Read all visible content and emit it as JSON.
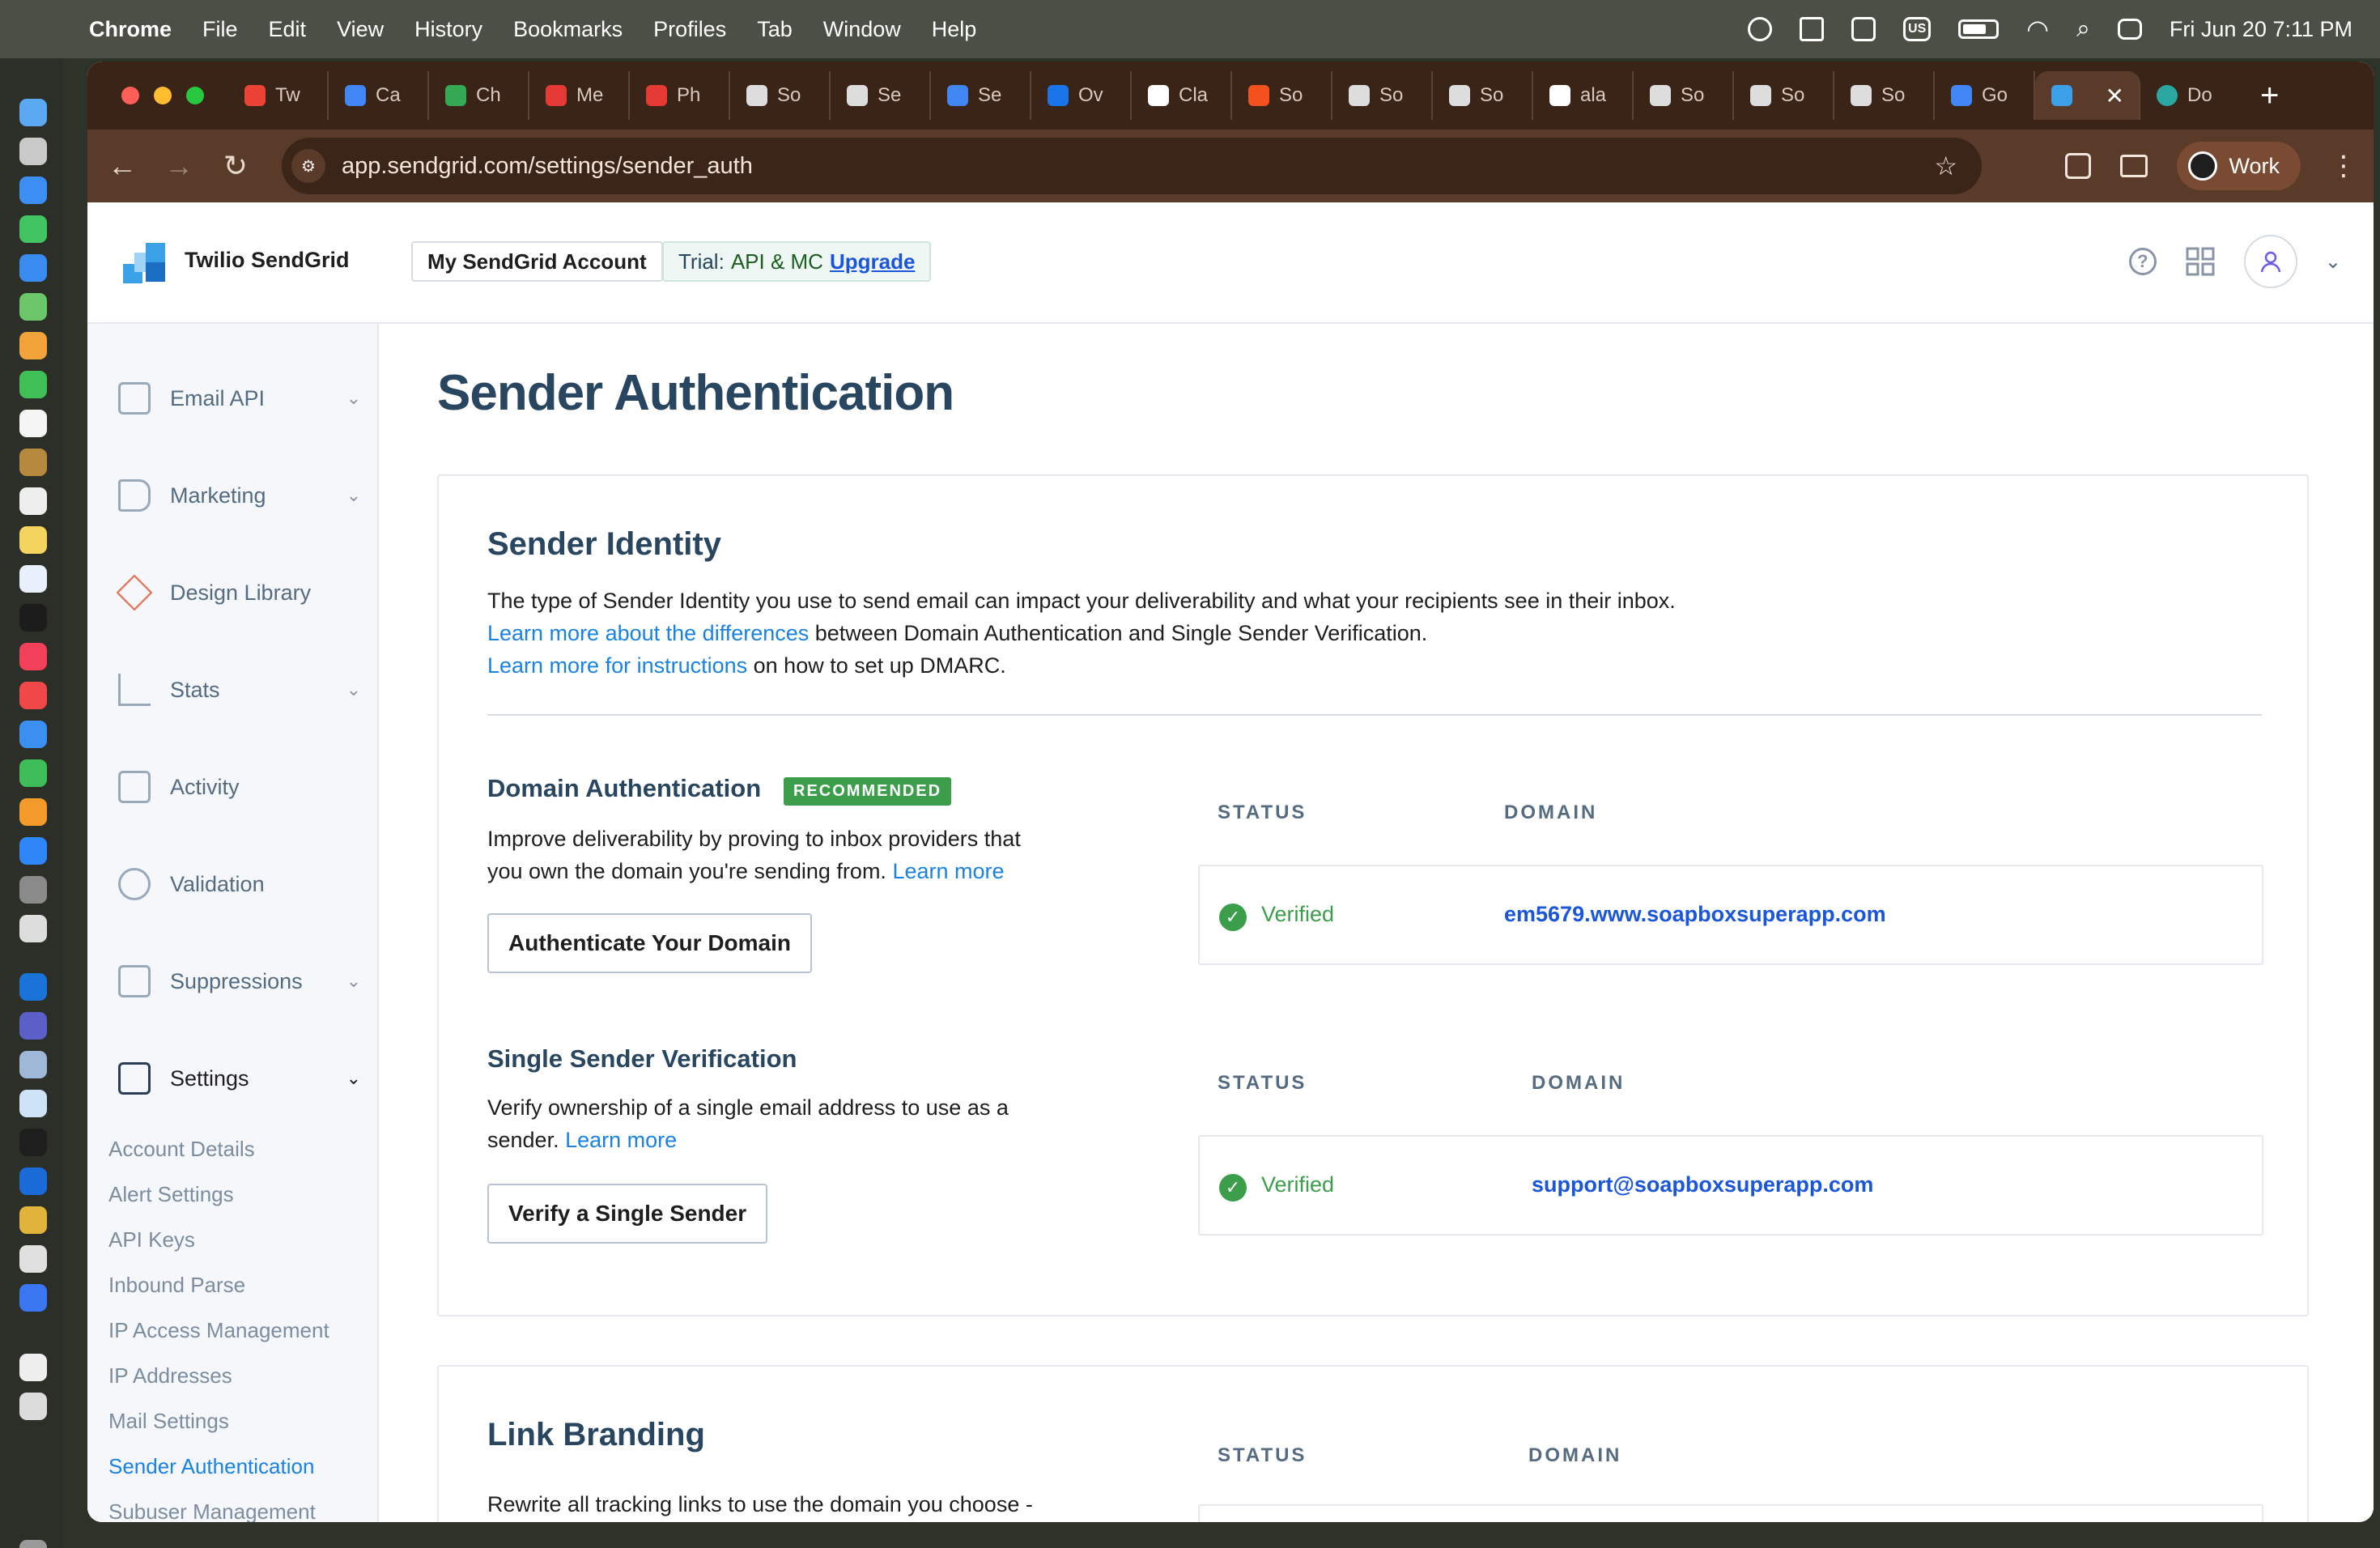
{
  "menubar": {
    "app": "Chrome",
    "items": [
      "File",
      "Edit",
      "View",
      "History",
      "Bookmarks",
      "Profiles",
      "Tab",
      "Window",
      "Help"
    ],
    "input_source": "US",
    "clock": "Fri Jun 20  7:11 PM"
  },
  "tabs": [
    {
      "label": "Tw",
      "color": "#ea4335"
    },
    {
      "label": "Ca",
      "color": "#4285f4"
    },
    {
      "label": "Ch",
      "color": "#34a853"
    },
    {
      "label": "Me",
      "color": "#e53935"
    },
    {
      "label": "Ph",
      "color": "#e53935"
    },
    {
      "label": "So",
      "color": "#dddddd"
    },
    {
      "label": "Se",
      "color": "#dddddd"
    },
    {
      "label": "Se",
      "color": "#4285f4"
    },
    {
      "label": "Ov",
      "color": "#1a73e8"
    },
    {
      "label": "Cla",
      "color": "#ffffff"
    },
    {
      "label": "So",
      "color": "#f4511e"
    },
    {
      "label": "So",
      "color": "#dddddd"
    },
    {
      "label": "So",
      "color": "#dddddd"
    },
    {
      "label": "ala",
      "color": "#ffffff"
    },
    {
      "label": "So",
      "color": "#dddddd"
    },
    {
      "label": "So",
      "color": "#dddddd"
    },
    {
      "label": "So",
      "color": "#dddddd"
    },
    {
      "label": "Go",
      "color": "#4285f4"
    }
  ],
  "active_tab": {
    "label": "",
    "close": "✕"
  },
  "after_tab": {
    "label": "Do"
  },
  "toolbar": {
    "url": "app.sendgrid.com/settings/sender_auth",
    "profile": "Work"
  },
  "header": {
    "brand": "Twilio SendGrid",
    "account_button": "My SendGrid Account",
    "trial_label": "Trial:",
    "trial_plan": "API & MC",
    "upgrade": "Upgrade"
  },
  "sidebar": {
    "items": [
      {
        "label": "Email API",
        "chevron": "⌄"
      },
      {
        "label": "Marketing",
        "chevron": "⌄"
      },
      {
        "label": "Design Library",
        "chevron": ""
      },
      {
        "label": "Stats",
        "chevron": "⌄"
      },
      {
        "label": "Activity",
        "chevron": ""
      },
      {
        "label": "Validation",
        "chevron": ""
      },
      {
        "label": "Suppressions",
        "chevron": "⌄"
      },
      {
        "label": "Settings",
        "chevron": "⌄"
      }
    ],
    "settings_sub": [
      "Account Details",
      "Alert Settings",
      "API Keys",
      "Inbound Parse",
      "IP Access Management",
      "IP Addresses",
      "Mail Settings",
      "Sender Authentication",
      "Subuser Management"
    ],
    "active_sub": "Sender Authentication"
  },
  "main": {
    "title": "Sender Authentication",
    "identity": {
      "heading": "Sender Identity",
      "line1": "The type of Sender Identity you use to send email can impact your deliverability and what your recipients see in their inbox.",
      "link2": "Learn more about the differences",
      "line2": " between Domain Authentication and Single Sender Verification.",
      "link3": "Learn more for instructions",
      "line3": " on how to set up DMARC."
    },
    "domain_auth": {
      "heading": "Domain Authentication",
      "badge": "RECOMMENDED",
      "desc1": "Improve deliverability by proving to inbox providers that",
      "desc2": "you own the domain you're sending from. ",
      "learn": "Learn more",
      "button": "Authenticate Your Domain",
      "col_status": "STATUS",
      "col_domain": "DOMAIN",
      "status": "Verified",
      "domain": "em5679.www.soapboxsuperapp.com"
    },
    "single_sender": {
      "heading": "Single Sender Verification",
      "desc1": "Verify ownership of a single email address to use as a",
      "desc2": "sender. ",
      "learn": "Learn more",
      "button": "Verify a Single Sender",
      "col_status": "STATUS",
      "col_domain": "DOMAIN",
      "status": "Verified",
      "domain": "support@soapboxsuperapp.com"
    },
    "link_branding": {
      "heading": "Link Branding",
      "desc": "Rewrite all tracking links to use the domain you choose -",
      "col_status": "STATUS",
      "col_domain": "DOMAIN"
    }
  },
  "colors": {
    "accent": "#1a82e2",
    "verified": "#3c9e4b",
    "heading": "#294661"
  }
}
